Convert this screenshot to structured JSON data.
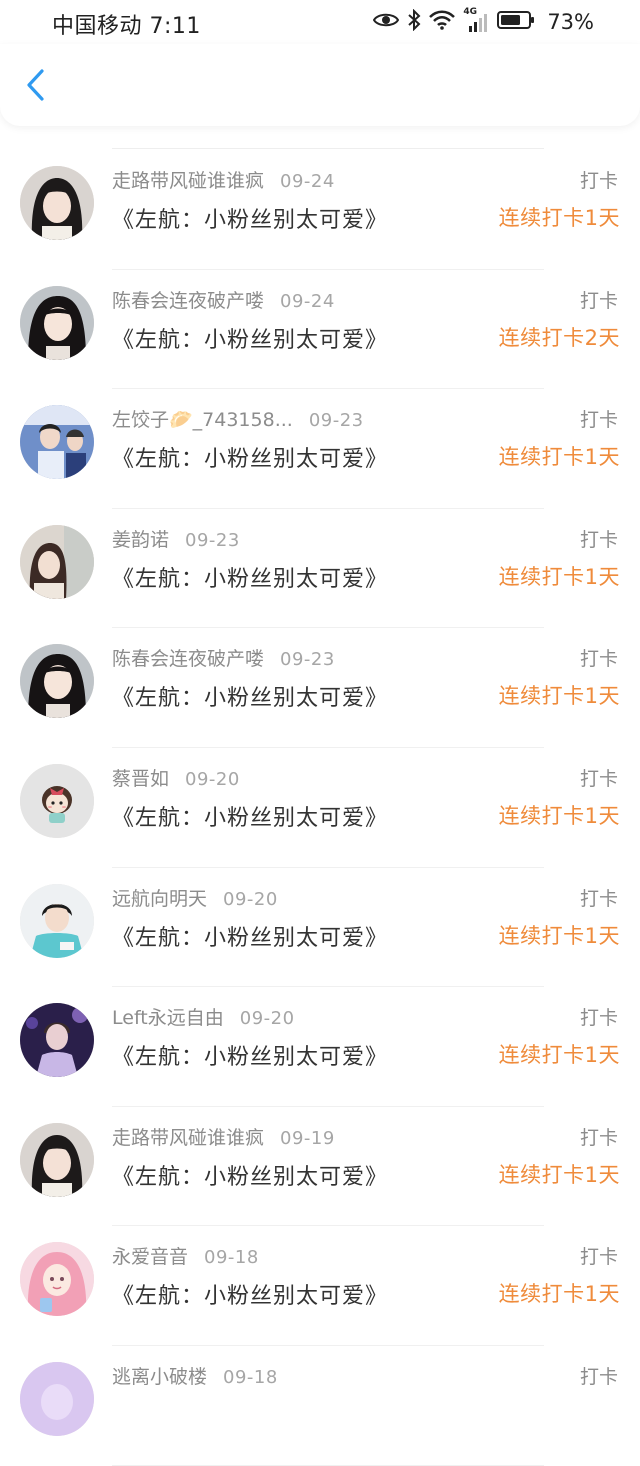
{
  "status_bar": {
    "carrier_time": "中国移动 7:11",
    "icons": [
      "eye-icon",
      "bluetooth-icon",
      "wifi-icon",
      "signal-4g-icon",
      "battery-icon"
    ],
    "network_label": "4G",
    "battery": "73%",
    "battery_level": 0.73
  },
  "header": {
    "back_icon": "chevron-left-icon",
    "accent_color": "#2f9af0"
  },
  "colors": {
    "streak": "#ef8b3b",
    "muted": "#8c8c8c",
    "title": "#333333"
  },
  "records": [
    {
      "user": "走路带风碰谁谁疯",
      "date": "09-24",
      "book": "《左航：小粉丝别太可爱》",
      "action": "打卡",
      "streak": "连续打卡1天",
      "avatar": "avatar-girl-dark-hair"
    },
    {
      "user": "陈春会连夜破产喽",
      "date": "09-24",
      "book": "《左航：小粉丝别太可爱》",
      "action": "打卡",
      "streak": "连续打卡2天",
      "avatar": "avatar-girl-long-hair"
    },
    {
      "user": "左饺子🥟_743158...",
      "date": "09-23",
      "book": "《左航：小粉丝别太可爱》",
      "action": "打卡",
      "streak": "连续打卡1天",
      "avatar": "avatar-boy-stage"
    },
    {
      "user": "姜韵诺",
      "date": "09-23",
      "book": "《左航：小粉丝别太可爱》",
      "action": "打卡",
      "streak": "连续打卡1天",
      "avatar": "avatar-girl-outdoor"
    },
    {
      "user": "陈春会连夜破产喽",
      "date": "09-23",
      "book": "《左航：小粉丝别太可爱》",
      "action": "打卡",
      "streak": "连续打卡1天",
      "avatar": "avatar-girl-long-hair"
    },
    {
      "user": "蔡晋如",
      "date": "09-20",
      "book": "《左航：小粉丝别太可爱》",
      "action": "打卡",
      "streak": "连续打卡1天",
      "avatar": "avatar-cartoon-girl"
    },
    {
      "user": "远航向明天",
      "date": "09-20",
      "book": "《左航：小粉丝别太可爱》",
      "action": "打卡",
      "streak": "连续打卡1天",
      "avatar": "avatar-boy-teal-shirt"
    },
    {
      "user": "Left永远自由",
      "date": "09-20",
      "book": "《左航：小粉丝别太可爱》",
      "action": "打卡",
      "streak": "连续打卡1天",
      "avatar": "avatar-boy-purple-light"
    },
    {
      "user": "走路带风碰谁谁疯",
      "date": "09-19",
      "book": "《左航：小粉丝别太可爱》",
      "action": "打卡",
      "streak": "连续打卡1天",
      "avatar": "avatar-girl-dark-hair"
    },
    {
      "user": "永爱音音",
      "date": "09-18",
      "book": "《左航：小粉丝别太可爱》",
      "action": "打卡",
      "streak": "连续打卡1天",
      "avatar": "avatar-illustrated-girl"
    },
    {
      "user": "逃离小破楼",
      "date": "09-18",
      "book": "",
      "action": "打卡",
      "streak": "",
      "avatar": "avatar-purple"
    }
  ]
}
